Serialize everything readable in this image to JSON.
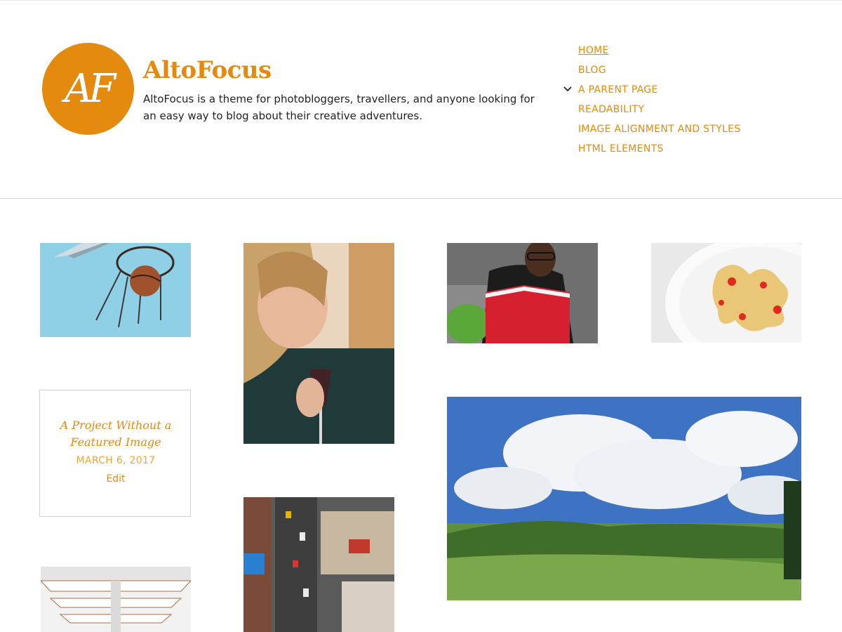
{
  "site": {
    "logo_text": "AF",
    "title": "AltoFocus",
    "description": "AltoFocus is a theme for photobloggers, travellers, and anyone looking for an easy way to blog about their creative adventures."
  },
  "nav": {
    "items": [
      {
        "label": "HOME",
        "current": true
      },
      {
        "label": "BLOG"
      },
      {
        "label": "A PARENT PAGE",
        "has_children": true,
        "icon": "chevron-down-icon"
      },
      {
        "label": "READABILITY"
      },
      {
        "label": "IMAGE ALIGNMENT AND STYLES"
      },
      {
        "label": "HTML ELEMENTS"
      }
    ]
  },
  "portfolio": {
    "thumbnails": [
      {
        "subject": "basketball-hoop"
      },
      {
        "subject": "woman-with-wine-glass"
      },
      {
        "subject": "man-reading-red-book"
      },
      {
        "subject": "plate-of-food"
      },
      {
        "subject": "landscape-hills-sky"
      },
      {
        "subject": "city-street-aerial"
      },
      {
        "subject": "library-interior"
      }
    ],
    "text_card": {
      "title": "A Project Without a Featured Image",
      "date": "MARCH 6, 2017",
      "edit_label": "Edit"
    }
  },
  "colors": {
    "accent": "#e38a0f",
    "date": "#eaa53c",
    "border": "#d6d6d6"
  }
}
